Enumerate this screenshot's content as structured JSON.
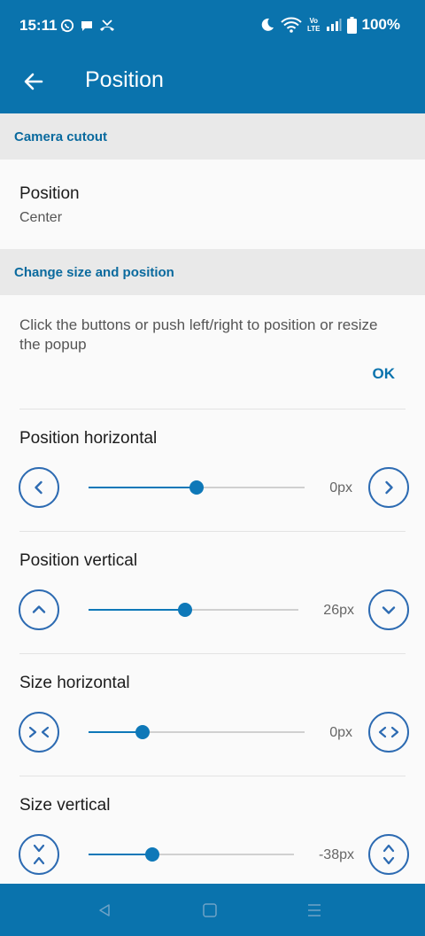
{
  "status_bar": {
    "time": "15:11",
    "left_icons": [
      "whatsapp-icon",
      "chat-icon",
      "missed-call-icon"
    ],
    "right_icons": [
      "moon-icon",
      "wifi-icon",
      "volte-icon",
      "signal-icon",
      "battery-icon"
    ],
    "volte_top": "Vo",
    "volte_bottom": "LTE",
    "battery": "100%"
  },
  "app_bar": {
    "title": "Position",
    "back_icon": "arrow-left-icon",
    "color": "#0a73ad"
  },
  "sections": {
    "camera_cutout": "Camera cutout",
    "change_size": "Change size and position"
  },
  "position_pref": {
    "title": "Position",
    "summary": "Center"
  },
  "instructions": {
    "text": "Click the buttons or push left/right to position or resize the popup",
    "ok_label": "OK"
  },
  "sliders": [
    {
      "title": "Position horizontal",
      "value": "0px",
      "fraction": 0.5,
      "dec_icon": "chevron-left-icon",
      "inc_icon": "chevron-right-icon"
    },
    {
      "title": "Position vertical",
      "value": "26px",
      "fraction": 0.46,
      "dec_icon": "chevron-up-icon",
      "inc_icon": "chevron-down-icon"
    },
    {
      "title": "Size horizontal",
      "value": "0px",
      "fraction": 0.25,
      "dec_icon": "shrink-horizontal-icon",
      "inc_icon": "expand-horizontal-icon"
    },
    {
      "title": "Size vertical",
      "value": "-38px",
      "fraction": 0.31,
      "dec_icon": "shrink-vertical-icon",
      "inc_icon": "expand-vertical-icon"
    }
  ],
  "nav_bar": {
    "buttons": [
      "back-triangle-icon",
      "home-square-icon",
      "recents-menu-icon"
    ]
  },
  "colors": {
    "primary": "#0a73ad",
    "accent": "#0e78b8",
    "section_text": "#0a6a9e",
    "button_outline": "#2d6bb2"
  }
}
